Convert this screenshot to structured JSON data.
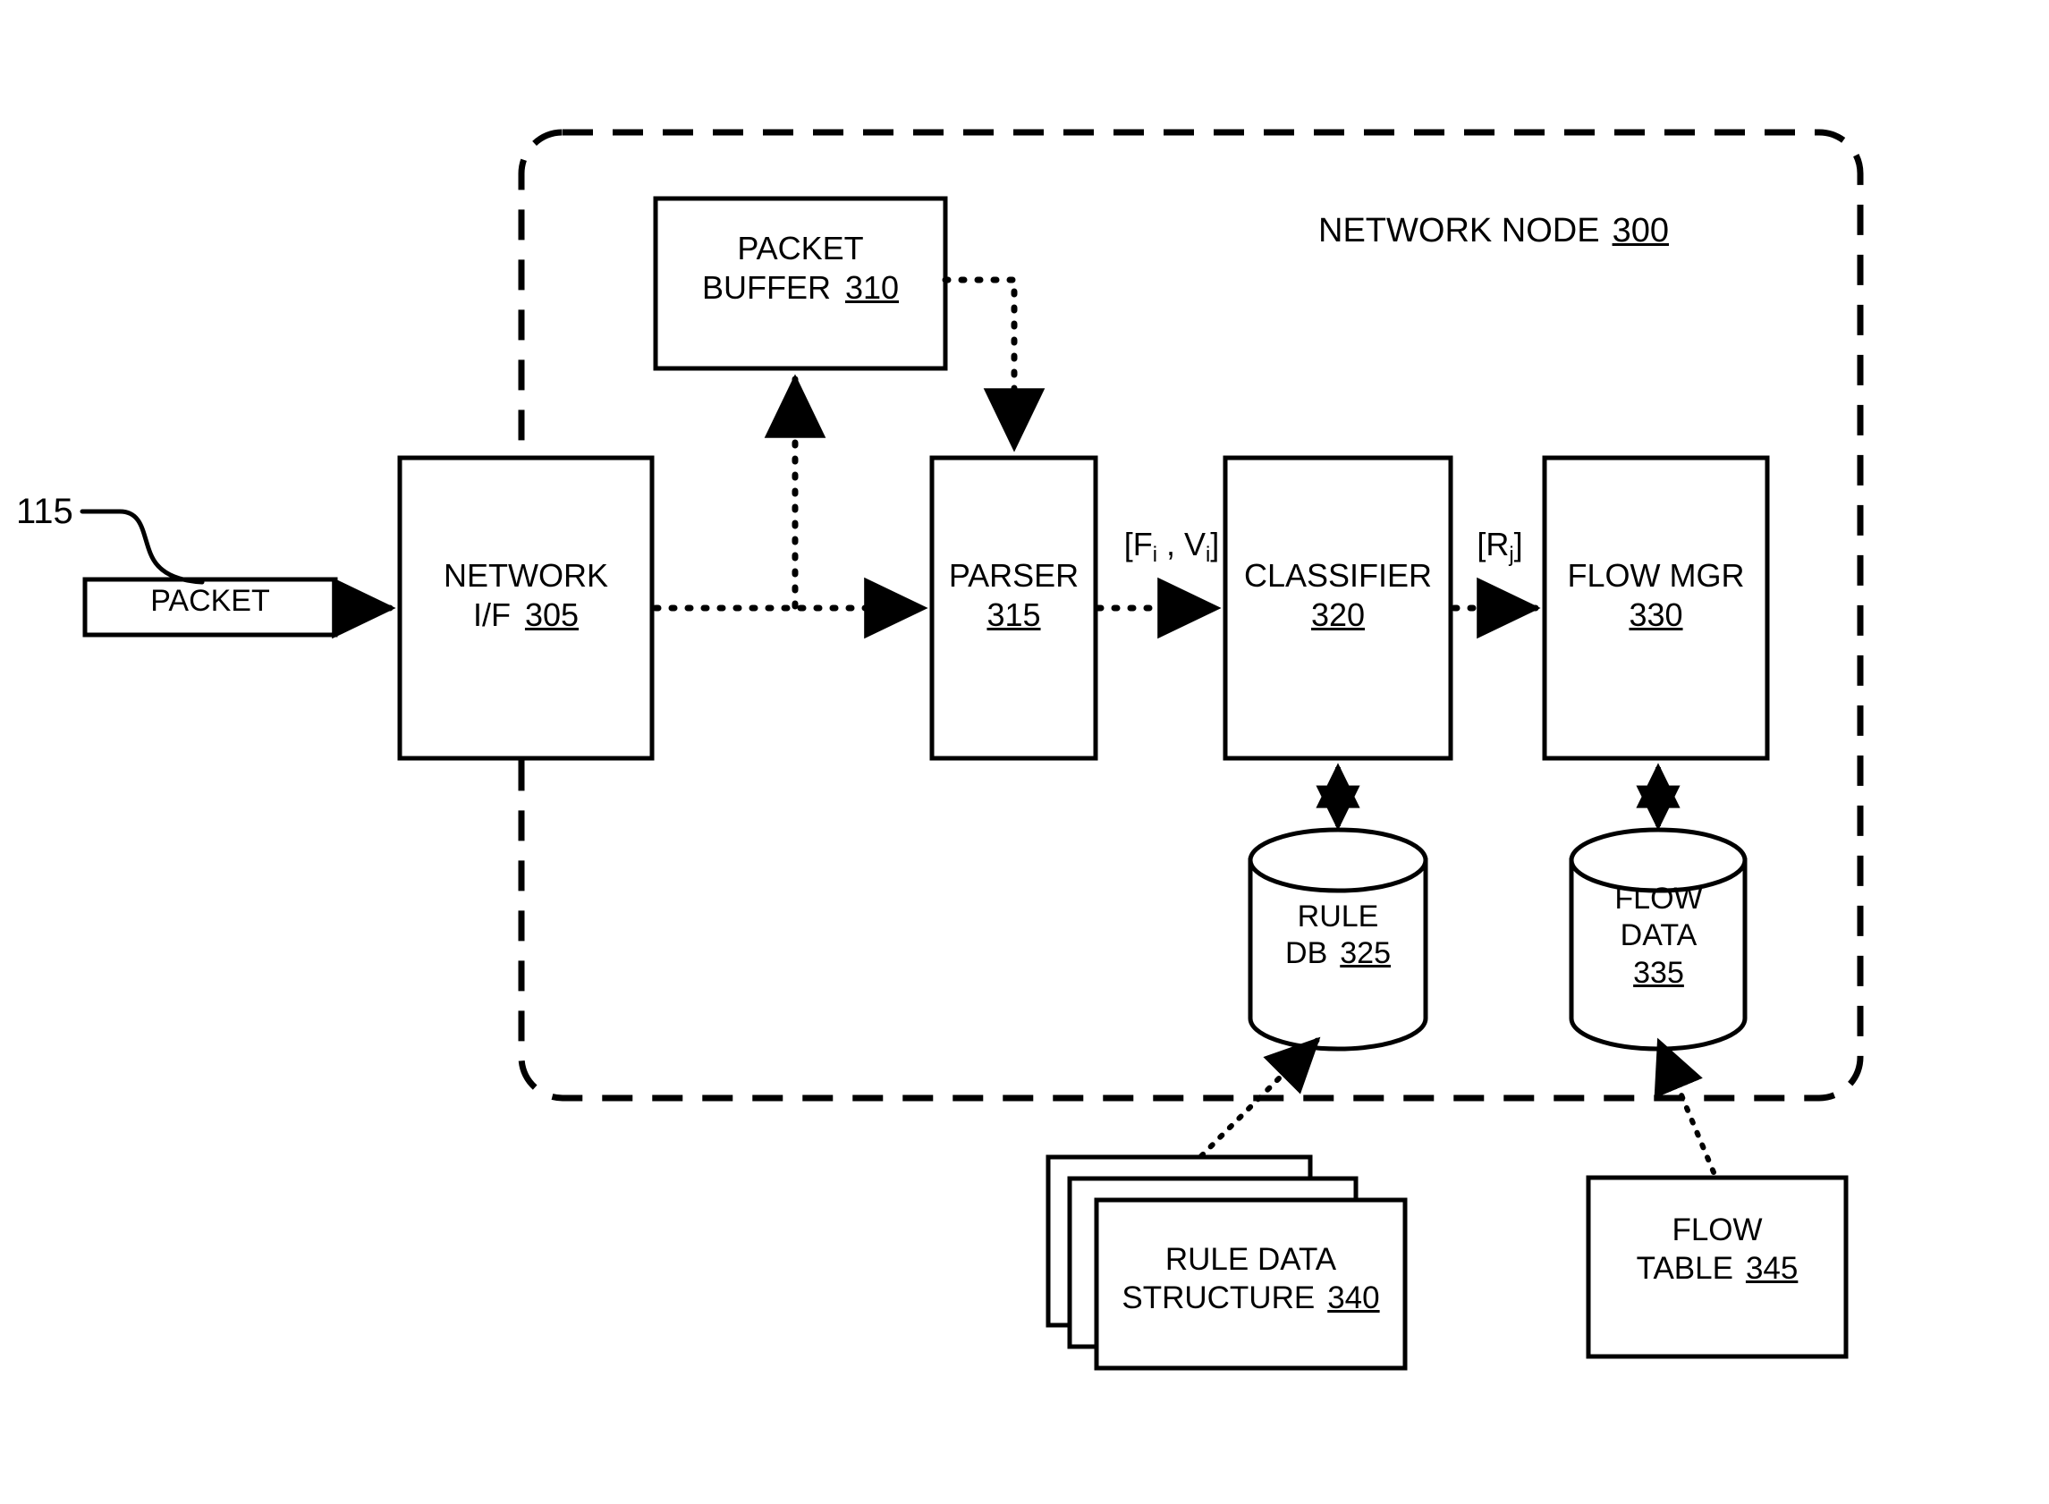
{
  "figure": {
    "type": "patent-block-diagram",
    "background_color": "#ffffff",
    "line_color": "#000000",
    "container": {
      "label_text": "NETWORK NODE",
      "ref": "300",
      "border_style": "dashed",
      "corner_style": "rounded"
    }
  },
  "nodes": {
    "packet": {
      "label": "PACKET",
      "ref": "115",
      "ref_position": "leader-line-upper-left",
      "shape": "rectangle",
      "inside_container": false
    },
    "network_if": {
      "line1": "NETWORK",
      "line2": "I/F",
      "ref": "305",
      "shape": "rectangle"
    },
    "packet_buffer": {
      "line1": "PACKET",
      "line2": "BUFFER",
      "ref": "310",
      "shape": "rectangle"
    },
    "parser": {
      "line1": "PARSER",
      "ref": "315",
      "shape": "rectangle"
    },
    "classifier": {
      "line1": "CLASSIFIER",
      "ref": "320",
      "shape": "rectangle"
    },
    "flow_mgr": {
      "line1": "FLOW MGR",
      "ref": "330",
      "shape": "rectangle"
    },
    "rule_db": {
      "line1": "RULE",
      "line2": "DB",
      "ref": "325",
      "shape": "cylinder"
    },
    "flow_data": {
      "line1": "FLOW",
      "line2": "DATA",
      "ref": "335",
      "shape": "cylinder"
    },
    "rule_data_structure": {
      "line1": "RULE DATA",
      "line2": "STRUCTURE",
      "ref": "340",
      "shape": "stacked-rectangles",
      "stack_count": 3,
      "inside_container": false
    },
    "flow_table": {
      "line1": "FLOW",
      "line2": "TABLE",
      "ref": "345",
      "shape": "rectangle",
      "inside_container": false
    }
  },
  "edge_labels": {
    "parser_to_classifier": {
      "prefix": "[F",
      "sub1": "i",
      "middle": " , V",
      "sub2": "i",
      "suffix": "]"
    },
    "classifier_to_flow_mgr": {
      "prefix": "[R",
      "sub1": "j",
      "suffix": "]"
    }
  },
  "edges": [
    {
      "from": "packet",
      "to": "network_if",
      "style": "dotted",
      "arrow": "single"
    },
    {
      "from": "network_if",
      "to": "parser",
      "style": "dotted",
      "arrow": "single"
    },
    {
      "from": "network_if",
      "to": "packet_buffer",
      "style": "dotted",
      "arrow": "single"
    },
    {
      "from": "packet_buffer",
      "to": "parser",
      "style": "dotted",
      "arrow": "single"
    },
    {
      "from": "parser",
      "to": "classifier",
      "style": "dotted",
      "arrow": "single"
    },
    {
      "from": "classifier",
      "to": "flow_mgr",
      "style": "dotted",
      "arrow": "single"
    },
    {
      "from": "classifier",
      "to": "rule_db",
      "style": "solid",
      "arrow": "double"
    },
    {
      "from": "flow_mgr",
      "to": "flow_data",
      "style": "solid",
      "arrow": "double"
    },
    {
      "from": "rule_data_structure",
      "to": "rule_db",
      "style": "dotted",
      "arrow": "single"
    },
    {
      "from": "flow_table",
      "to": "flow_data",
      "style": "dotted",
      "arrow": "single"
    }
  ]
}
